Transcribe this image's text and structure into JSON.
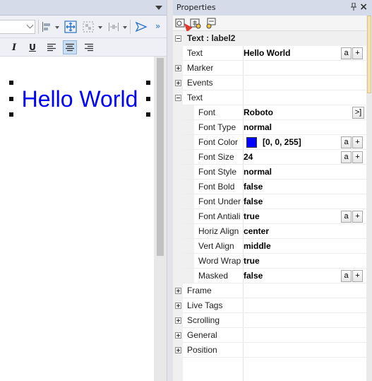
{
  "designer": {
    "label_text": "Hello World",
    "label_color": "#0000ff"
  },
  "panel": {
    "title": "Properties",
    "pin_symbol": "ᵖ",
    "close_symbol": "×"
  },
  "properties": {
    "header": "Text : label2",
    "text": {
      "name": "Text",
      "value": "Hello World"
    },
    "marker": "Marker",
    "events": "Events",
    "text_group": "Text",
    "font": {
      "name": "Font",
      "value": "Roboto"
    },
    "font_type": {
      "name": "Font Type",
      "value": "normal"
    },
    "font_color": {
      "name": "Font Color",
      "value": "[0, 0, 255]",
      "swatch": "#0000ff"
    },
    "font_size": {
      "name": "Font Size",
      "value": "24"
    },
    "font_style": {
      "name": "Font Style",
      "value": "normal"
    },
    "font_bold": {
      "name": "Font Bold",
      "value": "false"
    },
    "font_under": {
      "name": "Font Under",
      "value": "false"
    },
    "font_antialias": {
      "name": "Font Antiali",
      "value": "true"
    },
    "horiz_align": {
      "name": "Horiz Align",
      "value": "center"
    },
    "vert_align": {
      "name": "Vert Align",
      "value": "middle"
    },
    "word_wrap": {
      "name": "Word Wrap",
      "value": "true"
    },
    "masked": {
      "name": "Masked",
      "value": "false"
    },
    "frame": "Frame",
    "live_tags": "Live Tags",
    "scrolling": "Scrolling",
    "general": "General",
    "position": "Position"
  },
  "buttons": {
    "a": "a",
    "plus": "+",
    "more": ">]"
  }
}
